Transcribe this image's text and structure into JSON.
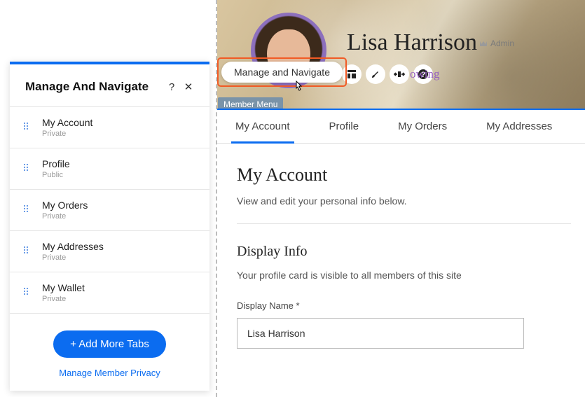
{
  "panel": {
    "title": "Manage And Navigate",
    "help": "?",
    "close": "✕",
    "tabs": [
      {
        "label": "My Account",
        "privacy": "Private"
      },
      {
        "label": "Profile",
        "privacy": "Public"
      },
      {
        "label": "My Orders",
        "privacy": "Private"
      },
      {
        "label": "My Addresses",
        "privacy": "Private"
      },
      {
        "label": "My Wallet",
        "privacy": "Private"
      }
    ],
    "add_button": "+  Add More Tabs",
    "manage_privacy_link": "Manage Member Privacy"
  },
  "callout": {
    "label": "Manage and Navigate",
    "member_menu_tag": "Member Menu"
  },
  "hero": {
    "username": "Lisa Harrison",
    "admin_label": "Admin",
    "following_text": "owing"
  },
  "tabs_nav": [
    {
      "label": "My Account",
      "active": true
    },
    {
      "label": "Profile",
      "active": false
    },
    {
      "label": "My Orders",
      "active": false
    },
    {
      "label": "My Addresses",
      "active": false
    }
  ],
  "main": {
    "title": "My Account",
    "subtitle": "View and edit your personal info below.",
    "section_title": "Display Info",
    "section_desc": "Your profile card is visible to all members of this site",
    "display_name_label": "Display Name *",
    "display_name_value": "Lisa Harrison"
  }
}
